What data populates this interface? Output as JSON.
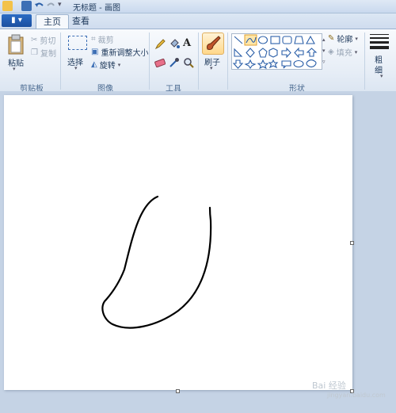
{
  "window": {
    "title": "无标题 - 画图"
  },
  "tabs": {
    "file": "▮ ▾",
    "home": "主页",
    "view": "查看"
  },
  "clipboard": {
    "paste": "粘贴",
    "cut": "剪切",
    "copy": "复制",
    "group": "剪贴板"
  },
  "image": {
    "select": "选择",
    "crop": "裁剪",
    "resize": "重新调整大小",
    "rotate": "旋转",
    "group": "图像"
  },
  "tools": {
    "group": "工具"
  },
  "brushes": {
    "label": "刷子"
  },
  "shapes": {
    "outline": "轮廓",
    "fill": "填充",
    "group": "形状"
  },
  "size": {
    "label_line1": "粗",
    "label_line2": "细"
  },
  "watermark": {
    "text": "Bai 经验",
    "sub": "jingyan.baidu.com"
  },
  "colors": {
    "accent": "#1a4fa0",
    "canvas": "#ffffff",
    "workspace": "#c5d3e5",
    "stroke": "#000000"
  }
}
